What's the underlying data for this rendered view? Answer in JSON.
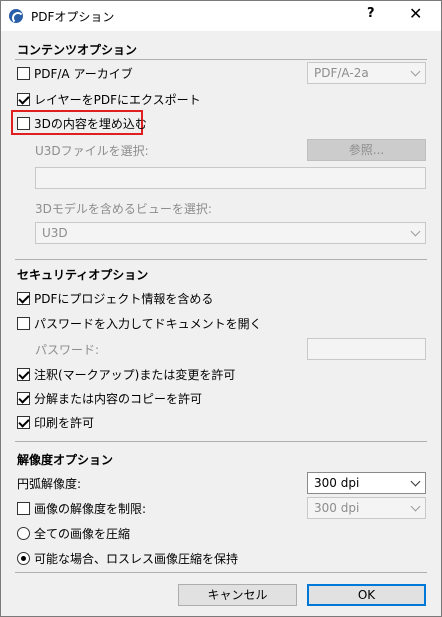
{
  "window": {
    "title": "PDFオプション",
    "help": "?",
    "close": "✕"
  },
  "content_options": {
    "heading": "コンテンツオプション",
    "pdfa": {
      "label": "PDF/A アーカイブ",
      "checked": false,
      "select_value": "PDF/A-2a"
    },
    "export_layers": {
      "label": "レイヤーをPDFにエクスポート",
      "checked": true
    },
    "embed_3d": {
      "label": "3Dの内容を埋め込む",
      "checked": false
    },
    "u3d_file": {
      "label": "U3Dファイルを選択:",
      "browse": "参照..."
    },
    "view_3d": {
      "label": "3Dモデルを含めるビューを選択:",
      "select_value": "U3D"
    }
  },
  "security_options": {
    "heading": "セキュリティオプション",
    "include_project_info": {
      "label": "PDFにプロジェクト情報を含める",
      "checked": true
    },
    "require_password": {
      "label": "パスワードを入力してドキュメントを開く",
      "checked": false
    },
    "password": {
      "label": "パスワード:"
    },
    "allow_annotations": {
      "label": "注釈(マークアップ)または変更を許可",
      "checked": true
    },
    "allow_copy": {
      "label": "分解または内容のコピーを許可",
      "checked": true
    },
    "allow_print": {
      "label": "印刷を許可",
      "checked": true
    }
  },
  "resolution_options": {
    "heading": "解像度オプション",
    "arc_resolution": {
      "label": "円弧解像度:",
      "select_value": "300 dpi"
    },
    "limit_image_resolution": {
      "label": "画像の解像度を制限:",
      "checked": false,
      "select_value": "300 dpi"
    },
    "compress_all": {
      "label": "全ての画像を圧縮",
      "selected": false
    },
    "keep_lossless": {
      "label": "可能な場合、ロスレス画像圧縮を保持",
      "selected": true
    }
  },
  "footer": {
    "cancel": "キャンセル",
    "ok": "OK"
  },
  "colors": {
    "highlight": "#e02020",
    "ok_border": "#0078d7"
  }
}
